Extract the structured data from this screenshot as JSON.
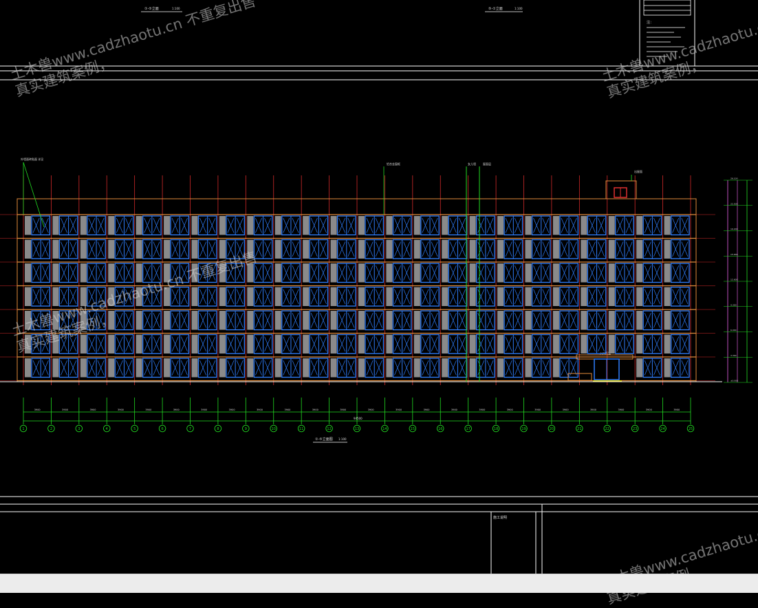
{
  "drawing": {
    "sheet_titles": {
      "top_left": "①-⑤立面",
      "top_left_scale": "1:100",
      "top_right": "⑤-①立面",
      "top_right_scale": "1:100",
      "main": "①-⑤立面图",
      "main_scale": "1:100"
    },
    "notes_label": "注：",
    "box_label": "施工说明",
    "dimension_total": "94500",
    "bay_dimensions": [
      "3900",
      "3900",
      "3900",
      "3900",
      "3900",
      "3900",
      "3900",
      "3900",
      "3900",
      "3900",
      "3900",
      "3900",
      "3900",
      "3900",
      "3900",
      "3900",
      "3900",
      "3900",
      "3900",
      "3900",
      "3900",
      "3900",
      "3900",
      "3900"
    ],
    "axis_labels": [
      "1",
      "2",
      "3",
      "4",
      "5",
      "6",
      "7",
      "8",
      "9",
      "10",
      "11",
      "12",
      "13",
      "14",
      "15",
      "16",
      "17",
      "18",
      "19",
      "20",
      "21",
      "22",
      "23",
      "24",
      "25"
    ],
    "annotations": {
      "top_left": "外墙面砖贴面 详见",
      "middle": "铝合金窗框",
      "right_1": "女儿墙",
      "right_2": "屋面层",
      "stair_tower": "出屋面",
      "entrance": "入口雨篷"
    },
    "level_marks": [
      "26.100",
      "22.500",
      "19.200",
      "15.900",
      "12.600",
      "9.300",
      "6.000",
      "3.300",
      "±0.000"
    ]
  },
  "watermark": {
    "line1": "土木兽www.cadzhaotu.cn  不重复出售",
    "line2": "真实建筑案例，"
  },
  "colors": {
    "background": "#000000",
    "frame": "#ffffff",
    "facade": "#e08a3a",
    "window": "#2f7fff",
    "pier": "#8a8a8a",
    "grid": "#d42a2a",
    "axis": "#22dd22",
    "label": "#dcdcdc"
  }
}
